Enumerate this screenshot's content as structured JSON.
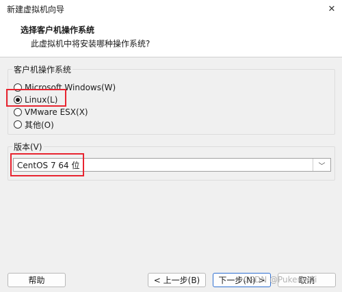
{
  "window": {
    "title": "新建虚拟机向导",
    "close_glyph": "✕"
  },
  "header": {
    "title": "选择客户机操作系统",
    "subtitle": "此虚拟机中将安装哪种操作系统?"
  },
  "os_group": {
    "legend": "客户机操作系统",
    "options": [
      {
        "label": "Microsoft Windows(W)",
        "checked": false
      },
      {
        "label": "Linux(L)",
        "checked": true
      },
      {
        "label": "VMware ESX(X)",
        "checked": false
      },
      {
        "label": "其他(O)",
        "checked": false
      }
    ]
  },
  "version_group": {
    "legend": "版本(V)",
    "selected": "CentOS 7 64 位",
    "arrow_glyph": "﹀"
  },
  "buttons": {
    "help": "帮助",
    "back": "< 上一步(B)",
    "next": "下一步(N) >",
    "cancel": "取消"
  },
  "watermark": "CSDN @Pukeriwei",
  "colors": {
    "annotation": "#e8232f",
    "primary_border": "#2f6fd1"
  }
}
